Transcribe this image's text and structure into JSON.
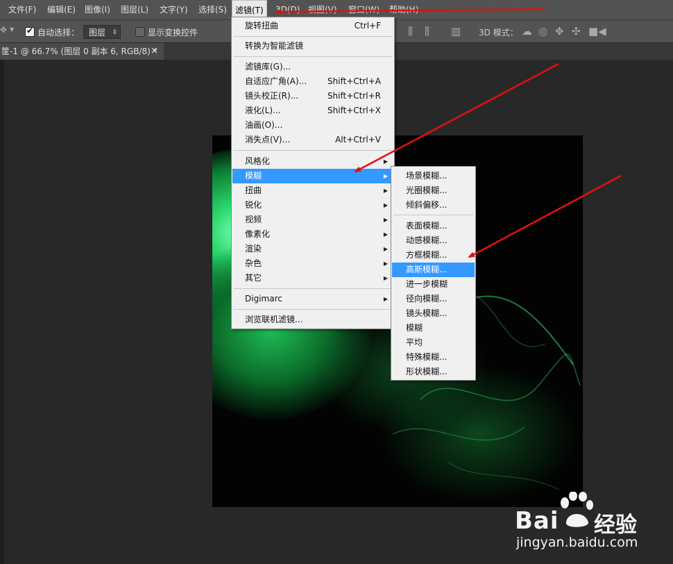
{
  "menubar": {
    "items": [
      {
        "label": "文件(F)"
      },
      {
        "label": "编辑(E)"
      },
      {
        "label": "图像(I)"
      },
      {
        "label": "图层(L)"
      },
      {
        "label": "文字(Y)"
      },
      {
        "label": "选择(S)"
      },
      {
        "label": "滤镜(T)"
      },
      {
        "label": "3D(D)"
      },
      {
        "label": "视图(V)"
      },
      {
        "label": "窗口(W)"
      },
      {
        "label": "帮助(H)"
      }
    ]
  },
  "options": {
    "auto_select_label": "自动选择：",
    "auto_select_checked": true,
    "layer_select": "图层",
    "show_transform_label": "显示变换控件",
    "show_transform_checked": false,
    "mode_3d_label": "3D 模式："
  },
  "document": {
    "tab_title": "筐-1 @ 66.7% (图层 0 副本 6, RGB/8) *",
    "close": "×"
  },
  "filter_menu": {
    "items": [
      {
        "label": "旋转扭曲",
        "shortcut": "Ctrl+F"
      },
      {
        "label": "转换为智能滤镜"
      },
      {
        "label": "滤镜库(G)..."
      },
      {
        "label": "自适应广角(A)...",
        "shortcut": "Shift+Ctrl+A"
      },
      {
        "label": "镜头校正(R)...",
        "shortcut": "Shift+Ctrl+R"
      },
      {
        "label": "液化(L)...",
        "shortcut": "Shift+Ctrl+X"
      },
      {
        "label": "油画(O)..."
      },
      {
        "label": "消失点(V)...",
        "shortcut": "Alt+Ctrl+V"
      },
      {
        "label": "风格化"
      },
      {
        "label": "模糊"
      },
      {
        "label": "扭曲"
      },
      {
        "label": "锐化"
      },
      {
        "label": "视频"
      },
      {
        "label": "像素化"
      },
      {
        "label": "渲染"
      },
      {
        "label": "杂色"
      },
      {
        "label": "其它"
      },
      {
        "label": "Digimarc"
      },
      {
        "label": "浏览联机滤镜..."
      }
    ]
  },
  "blur_submenu": {
    "items": [
      {
        "label": "场景模糊..."
      },
      {
        "label": "光圈模糊..."
      },
      {
        "label": "倾斜偏移..."
      },
      {
        "label": "表面模糊..."
      },
      {
        "label": "动感模糊..."
      },
      {
        "label": "方框模糊..."
      },
      {
        "label": "高斯模糊..."
      },
      {
        "label": "进一步模糊"
      },
      {
        "label": "径向模糊..."
      },
      {
        "label": "镜头模糊..."
      },
      {
        "label": "模糊"
      },
      {
        "label": "平均"
      },
      {
        "label": "特殊模糊..."
      },
      {
        "label": "形状模糊..."
      }
    ]
  },
  "watermark": {
    "brand": "Bai",
    "brand_cn": "经验",
    "url": "jingyan.baidu.com"
  },
  "colors": {
    "highlight": "#3399ff",
    "annotation_arrow": "#e01010",
    "glow": "#1fd86a"
  }
}
